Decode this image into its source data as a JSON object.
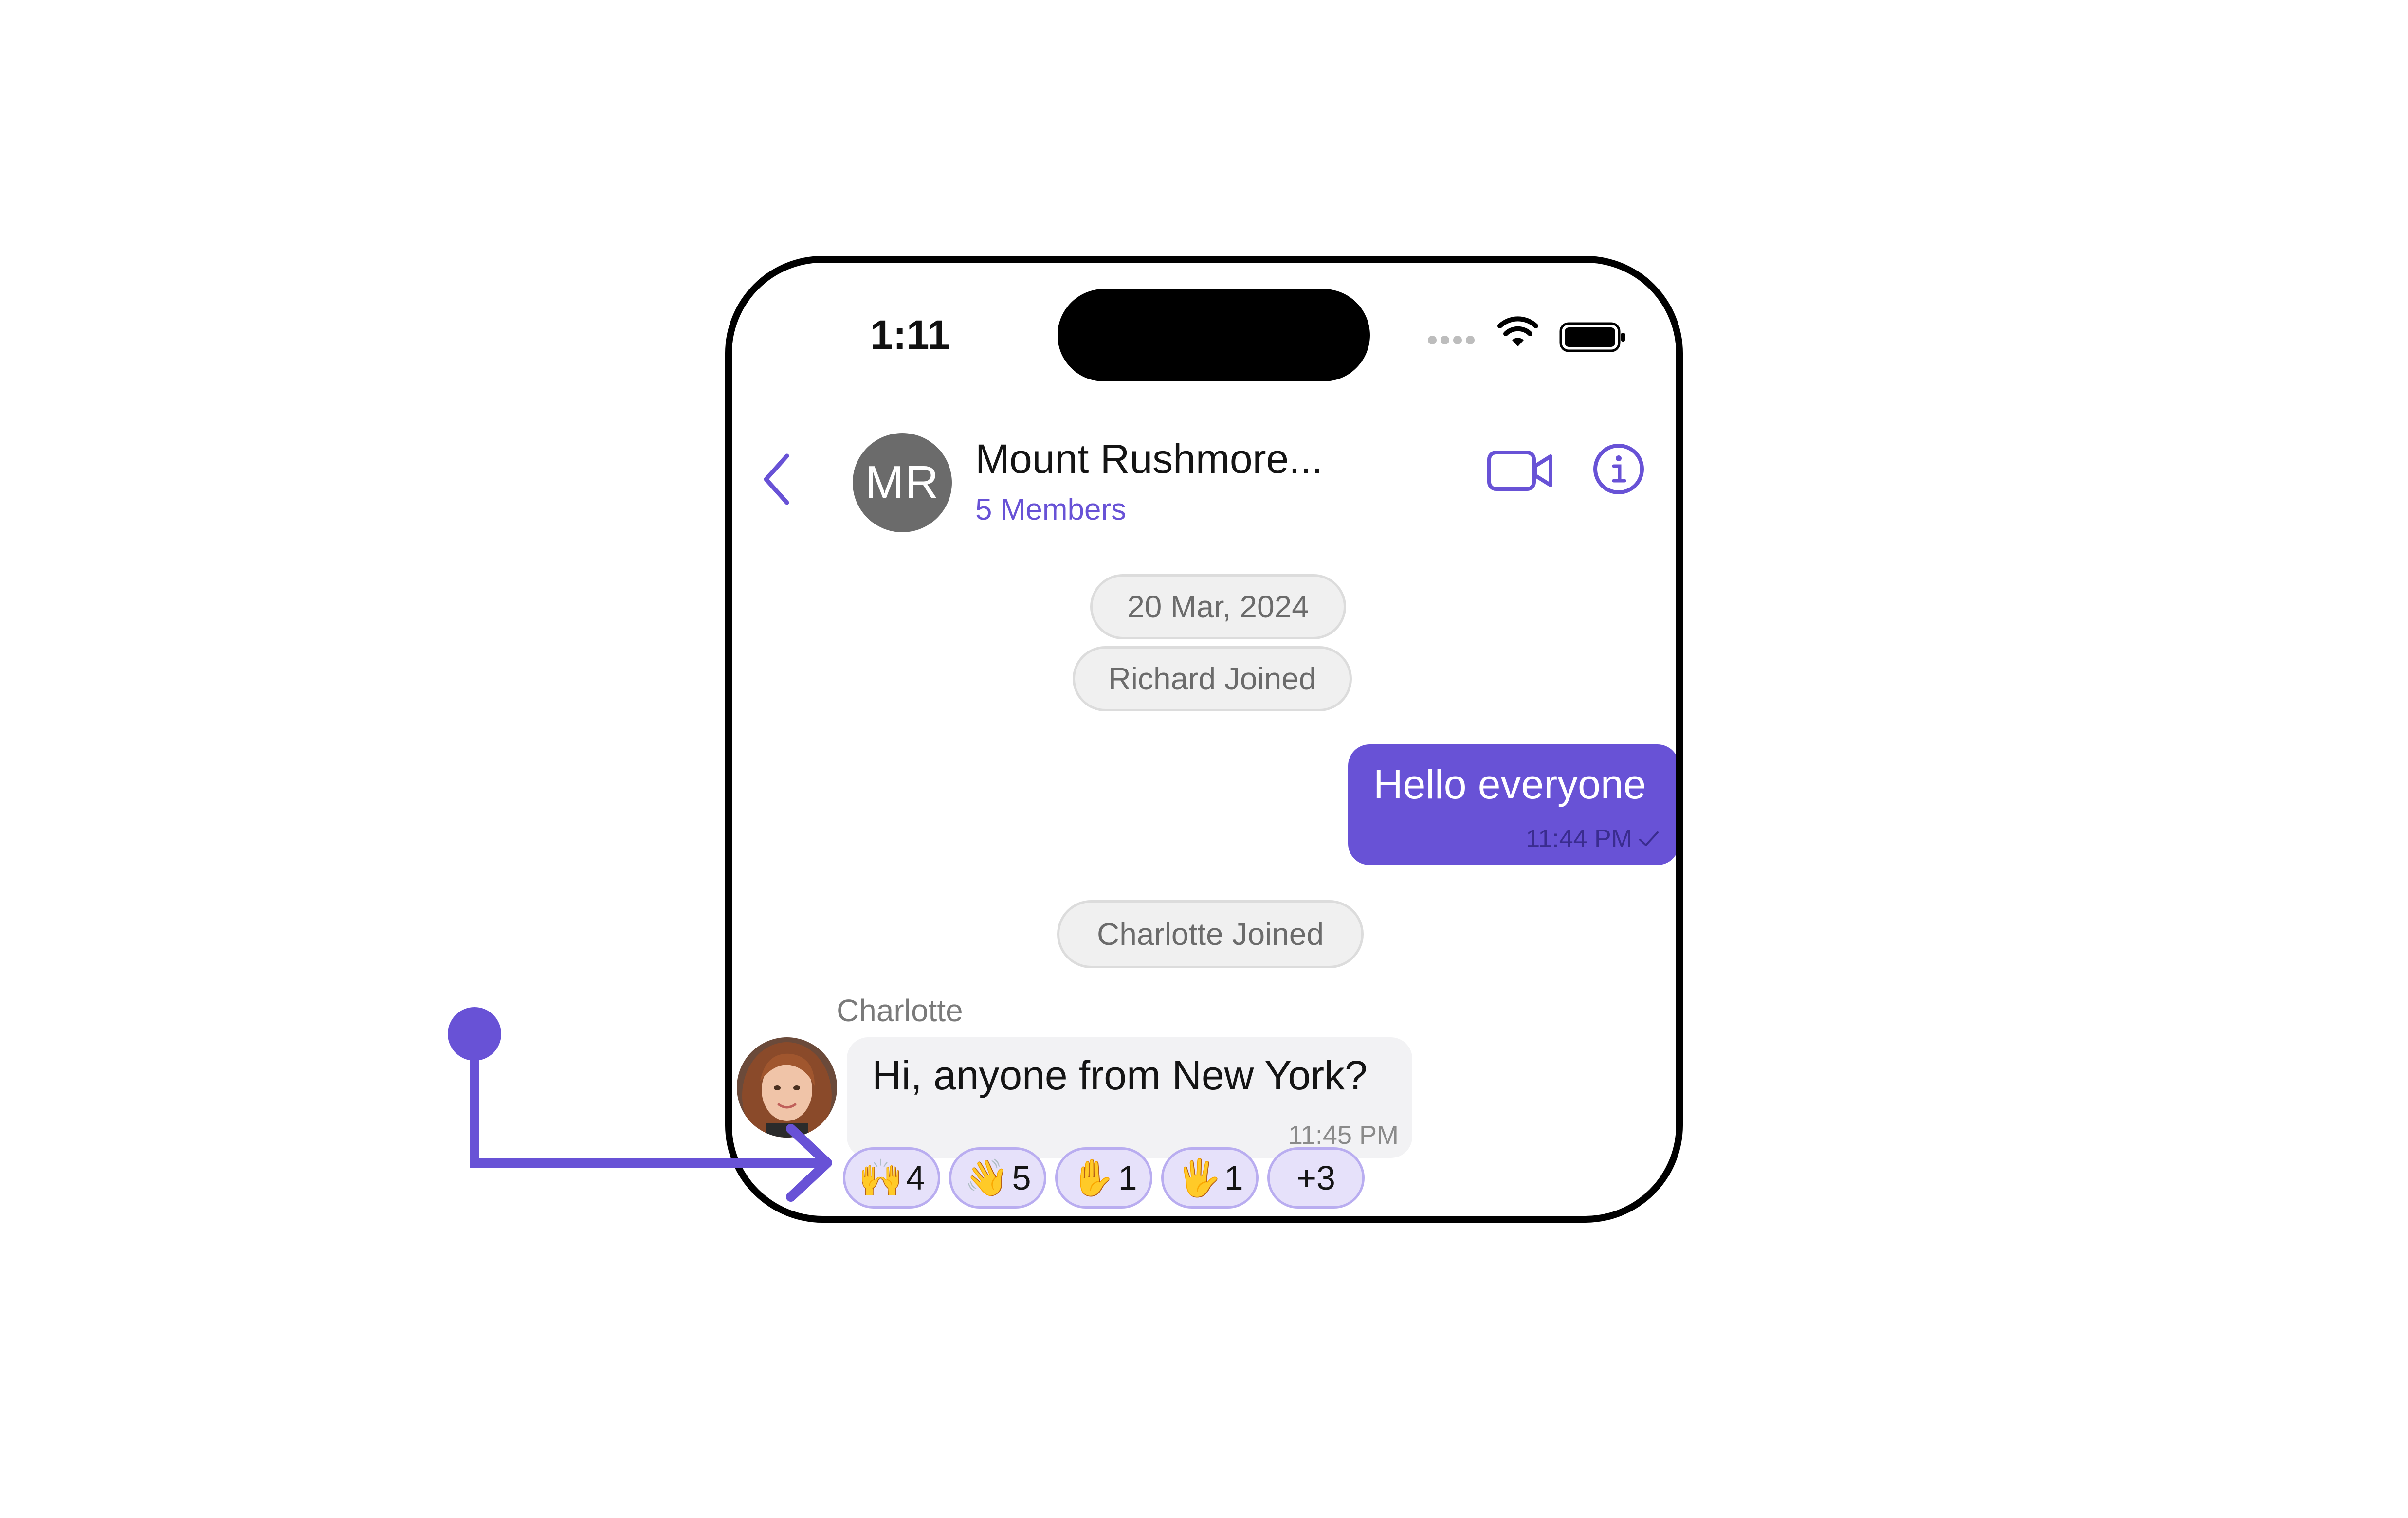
{
  "status_bar": {
    "time": "1:11"
  },
  "header": {
    "avatar_initials": "MR",
    "title": "Mount Rushmore...",
    "subtitle": "5 Members"
  },
  "messages": {
    "date_chip": "20 Mar, 2024",
    "system_1": "Richard Joined",
    "outgoing": {
      "text": "Hello everyone",
      "time": "11:44 PM"
    },
    "system_2": "Charlotte Joined",
    "incoming": {
      "sender": "Charlotte",
      "text": "Hi, anyone from New York?",
      "time": "11:45 PM"
    }
  },
  "reactions": [
    {
      "emoji": "🙌",
      "count": "4"
    },
    {
      "emoji": "👋",
      "count": "5"
    },
    {
      "emoji": "✋",
      "count": "1"
    },
    {
      "emoji": "🖐",
      "count": "1"
    }
  ],
  "more_reactions": "+3",
  "colors": {
    "accent": "#6852D6",
    "reaction_bg": "#E6E1FA",
    "incoming_bubble": "#F2F2F4",
    "system_chip": "#F0F0F0"
  },
  "icons": [
    "back-chevron-icon",
    "video-call-icon",
    "info-icon",
    "wifi-icon",
    "battery-icon",
    "read-tick-icon"
  ]
}
